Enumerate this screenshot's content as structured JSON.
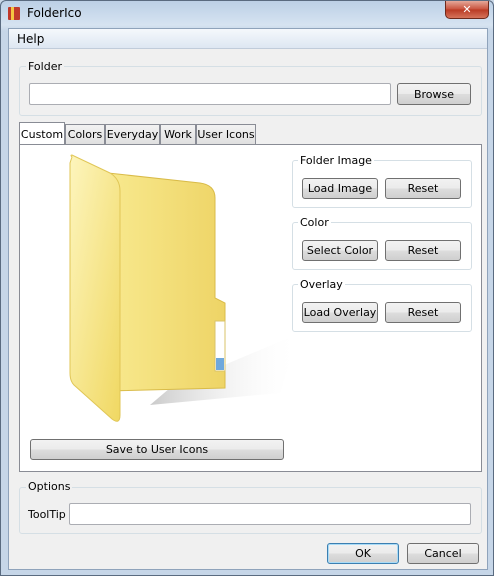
{
  "window": {
    "title": "FolderIco",
    "close_glyph": "✕"
  },
  "menu": {
    "help": "Help"
  },
  "folder_section": {
    "label": "Folder",
    "path_value": "",
    "browse": "Browse"
  },
  "tabs": [
    {
      "label": "Custom",
      "active": true
    },
    {
      "label": "Colors",
      "active": false
    },
    {
      "label": "Everyday",
      "active": false
    },
    {
      "label": "Work",
      "active": false
    },
    {
      "label": "User Icons",
      "active": false
    }
  ],
  "custom_tab": {
    "preview_icon": "folder-icon",
    "folder_image": {
      "title": "Folder Image",
      "load": "Load Image",
      "reset": "Reset"
    },
    "color": {
      "title": "Color",
      "select": "Select Color",
      "reset": "Reset"
    },
    "overlay": {
      "title": "Overlay",
      "load": "Load Overlay",
      "reset": "Reset"
    },
    "save": "Save to User Icons"
  },
  "options": {
    "title": "Options",
    "tooltip_label": "ToolTip",
    "tooltip_value": ""
  },
  "footer": {
    "ok": "OK",
    "cancel": "Cancel"
  },
  "colors": {
    "folder_light": "#fbf0a8",
    "folder_mid": "#f2df74",
    "folder_dark": "#e1c452",
    "accent_blue": "#3c7fb1"
  }
}
